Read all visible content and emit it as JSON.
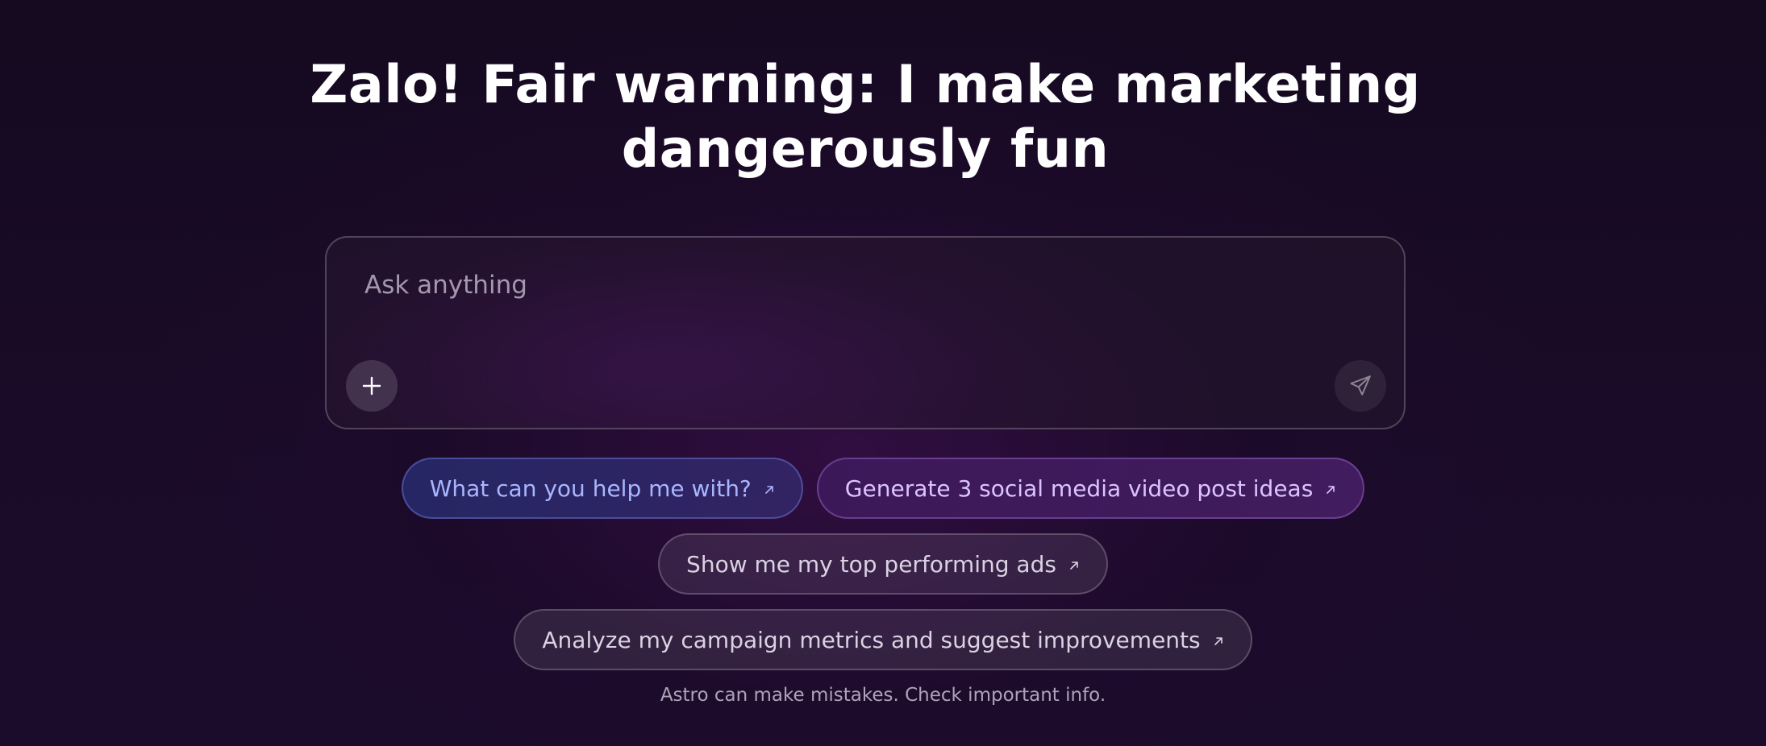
{
  "hero": {
    "headline_line1": "Zalo! Fair warning: I make marketing",
    "headline_line2": "dangerously fun"
  },
  "composer": {
    "placeholder": "Ask anything",
    "attach_icon": "plus-icon",
    "send_icon": "send-icon"
  },
  "suggestions": [
    {
      "label": "What can you help me with?",
      "style": "blue",
      "icon": "arrow-up-right-icon"
    },
    {
      "label": "Generate 3 social media video post ideas",
      "style": "purple",
      "icon": "arrow-up-right-icon"
    },
    {
      "label": "Show me my top performing ads",
      "style": "neutral",
      "icon": "arrow-up-right-icon"
    },
    {
      "label": "Analyze my campaign metrics and suggest improvements",
      "style": "neutral",
      "icon": "arrow-up-right-icon"
    }
  ],
  "footer": {
    "disclaimer": "Astro can make mistakes. Check important info."
  },
  "colors": {
    "background": "#170a24",
    "chip_blue_text": "#a9b6ff",
    "chip_purple_text": "#dcc4ff",
    "chip_neutral_text": "#dad2e2"
  }
}
